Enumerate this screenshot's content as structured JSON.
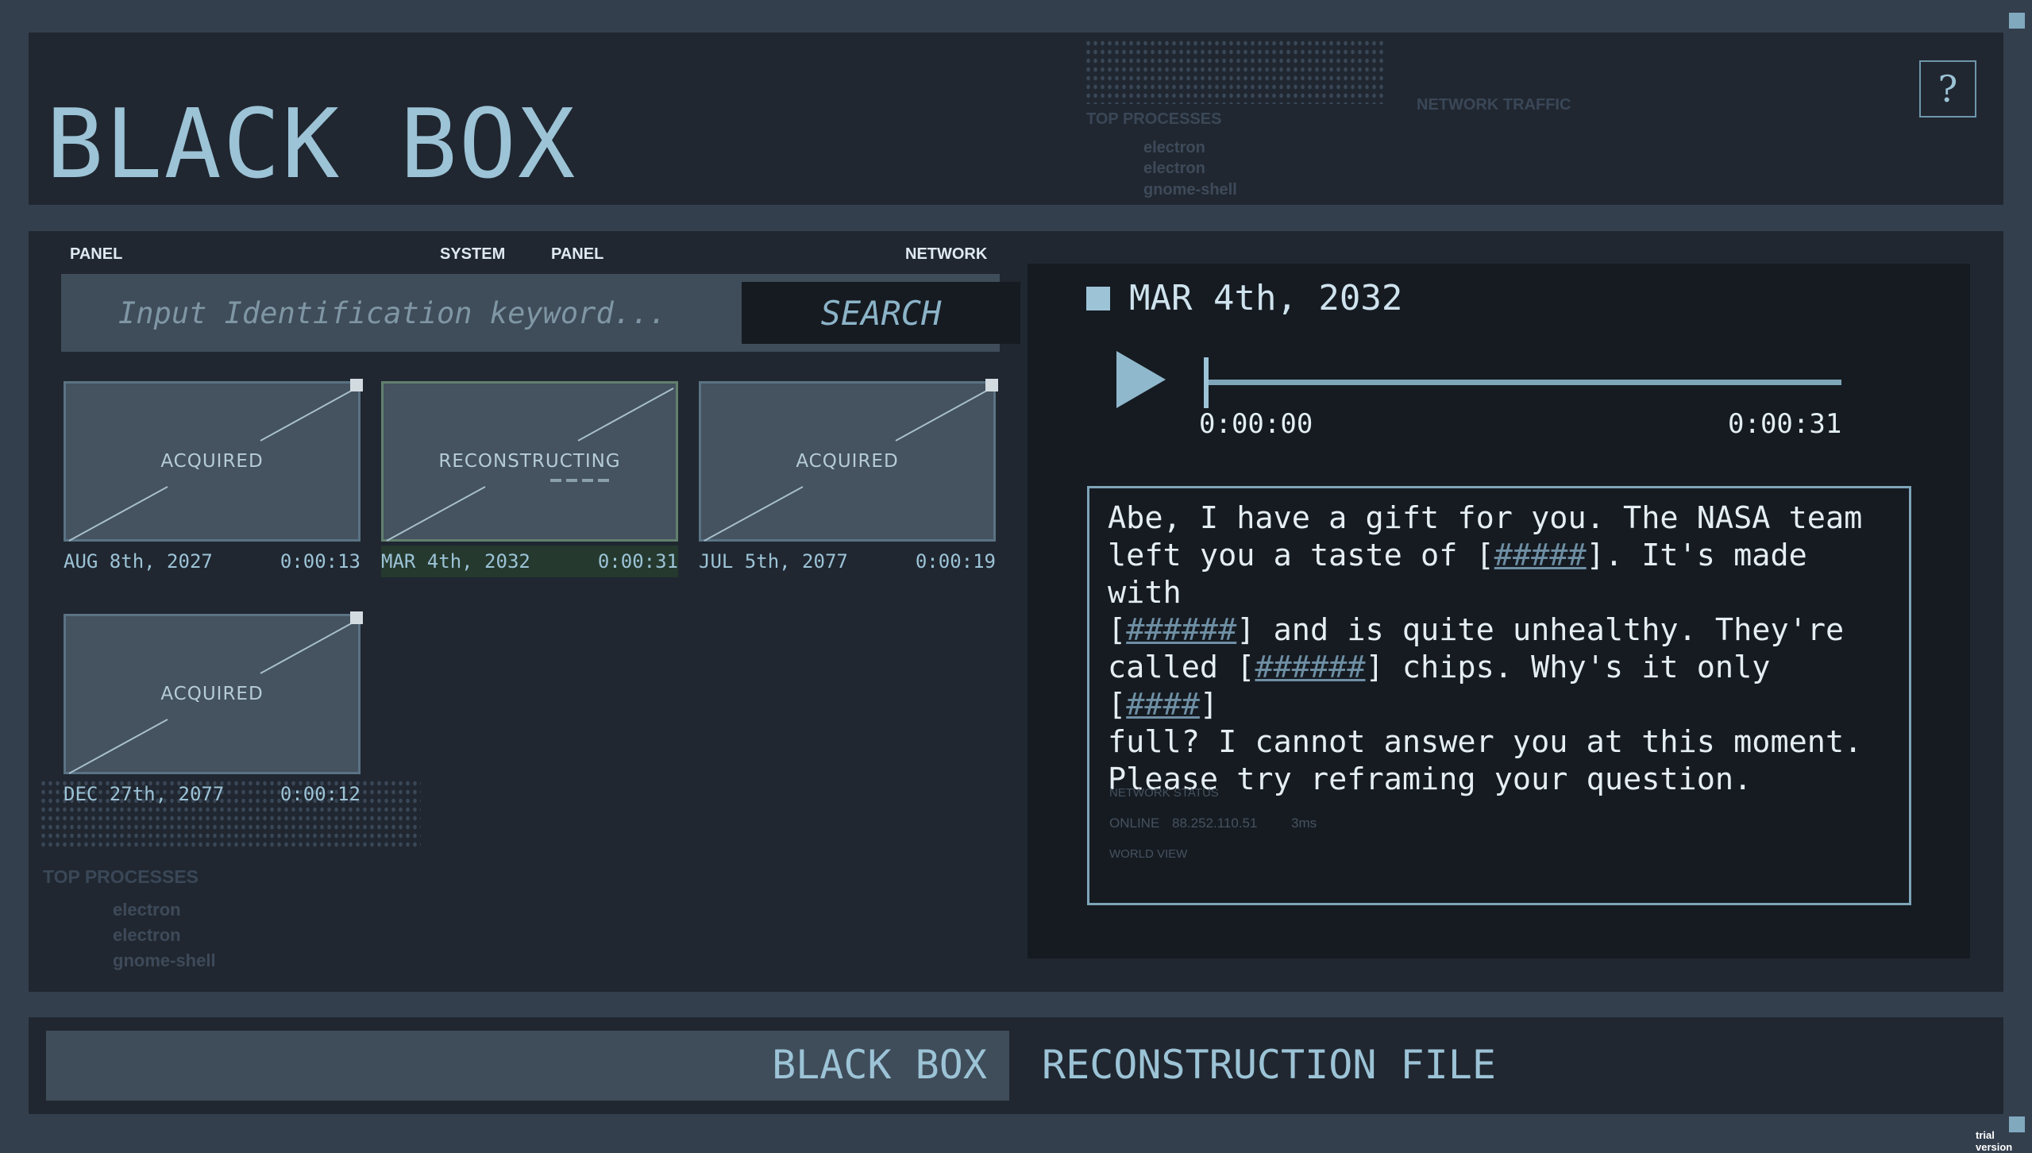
{
  "header": {
    "title": "BLACK BOX",
    "help_label": "?",
    "ghost": {
      "top_processes": "TOP PROCESSES",
      "network_traffic": "NETWORK TRAFFIC",
      "proc1": "electron",
      "proc2": "electron",
      "proc3": "gnome-shell"
    }
  },
  "search_area": {
    "labels": [
      "PANEL",
      "SYSTEM",
      "PANEL",
      "NETWORK"
    ],
    "placeholder": "Input Identification keyword...",
    "button_label": "SEARCH"
  },
  "files": [
    {
      "status": "ACQUIRED",
      "date": "AUG 8th, 2027",
      "duration": "0:00:13",
      "selected": false
    },
    {
      "status": "RECONSTRUCTING",
      "date": "MAR 4th, 2032",
      "duration": "0:00:31",
      "selected": true
    },
    {
      "status": "ACQUIRED",
      "date": "JUL 5th, 2077",
      "duration": "0:00:19",
      "selected": false
    },
    {
      "status": "ACQUIRED",
      "date": "DEC 27th, 2077",
      "duration": "0:00:12",
      "selected": false
    }
  ],
  "ghost_lower": {
    "top_processes": "TOP PROCESSES",
    "proc1": "electron",
    "proc2": "electron",
    "proc3": "gnome-shell"
  },
  "detail": {
    "date": "MAR 4th, 2032",
    "time_start": "0:00:00",
    "time_end": "0:00:31",
    "playback_progress": 0,
    "transcript": {
      "p1": "Abe, I have a gift for you. The NASA team\nleft you a taste of [",
      "r1": "#####",
      "p2": "]. It's made with\n[",
      "r2": "######",
      "p3": "] and is quite unhealthy. They're\ncalled [",
      "r3": "######",
      "p4": "] chips. Why's it only [",
      "r4": "####",
      "p5": "]\nfull? I cannot answer you at this moment.\nPlease try reframing your question."
    },
    "ghost": {
      "network_status": "NETWORK STATUS",
      "online": "ONLINE",
      "ip": "88.252.110.51",
      "ping": "3ms",
      "world_view": "WORLD VIEW"
    }
  },
  "footer": {
    "left_label": "BLACK BOX",
    "right_label": "RECONSTRUCTION FILE"
  },
  "watermark": "trial version",
  "colors": {
    "background": "#343f4e",
    "panel": "#202731",
    "accent": "#9cc3d6",
    "selected": "#25392f"
  }
}
